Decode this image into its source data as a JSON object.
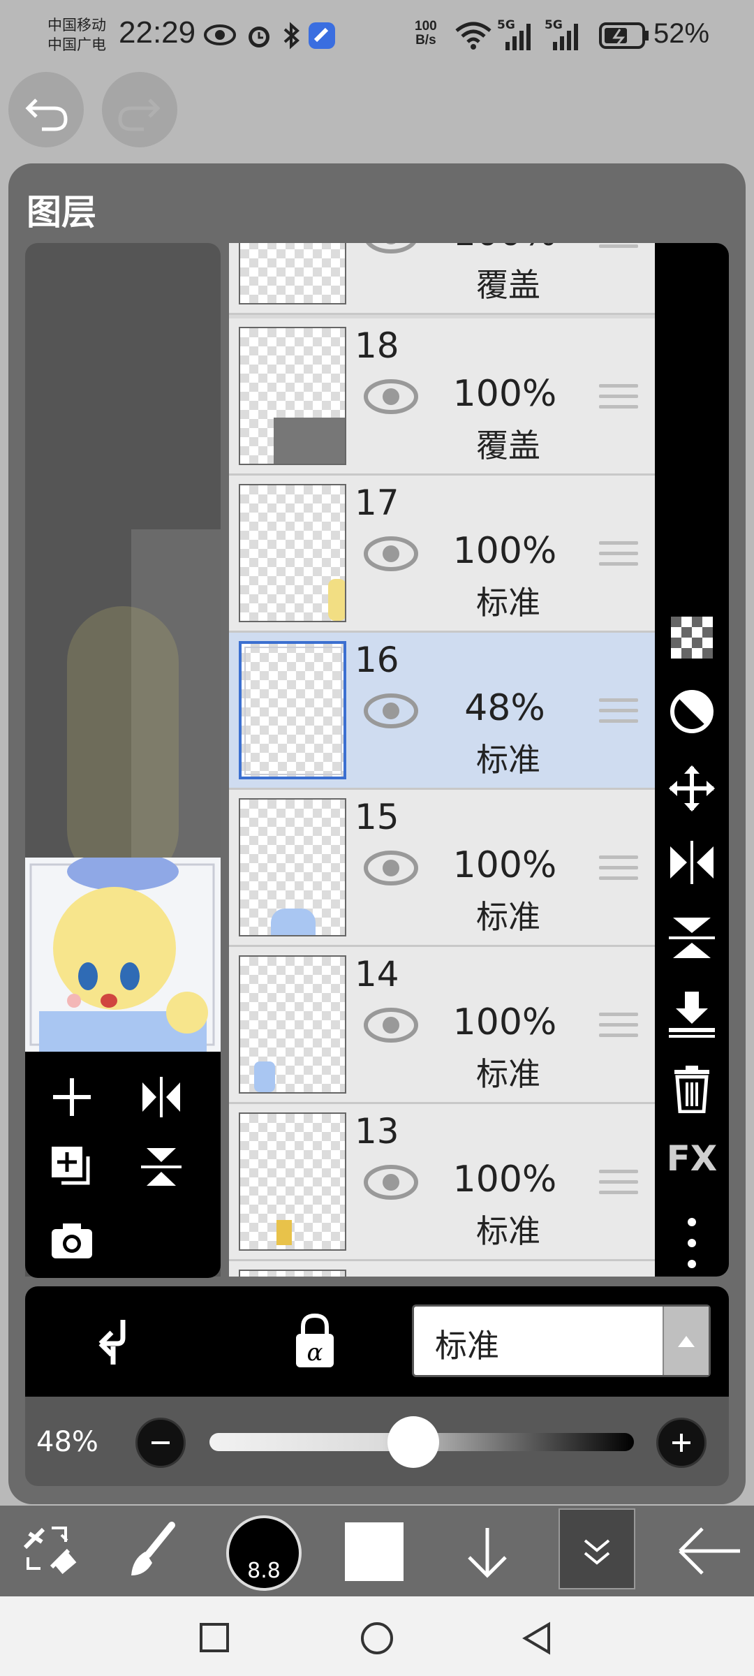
{
  "status_bar": {
    "carrier_line1": "中国移动",
    "carrier_line2": "中国广电",
    "time": "22:29",
    "net_speed_value": "100",
    "net_speed_unit": "B/s",
    "signal_1": "5G",
    "signal_2": "5G",
    "battery": "52%"
  },
  "panel": {
    "title": "图层"
  },
  "layers": [
    {
      "number": "",
      "opacity": "100%",
      "mode": "覆盖"
    },
    {
      "number": "18",
      "opacity": "100%",
      "mode": "覆盖"
    },
    {
      "number": "17",
      "opacity": "100%",
      "mode": "标准"
    },
    {
      "number": "16",
      "opacity": "48%",
      "mode": "标准",
      "selected": true
    },
    {
      "number": "15",
      "opacity": "100%",
      "mode": "标准"
    },
    {
      "number": "14",
      "opacity": "100%",
      "mode": "标准"
    },
    {
      "number": "13",
      "opacity": "100%",
      "mode": "标准"
    }
  ],
  "right_tools": {
    "fx_label": "FX"
  },
  "controls": {
    "blend_mode": "标准",
    "opacity_label": "48%",
    "opacity_value": 0.48
  },
  "toolbar": {
    "brush_size": "8.8"
  },
  "colors": {
    "panel": "#6b6b6b",
    "selected_row": "#cfdcf0",
    "selection_border": "#3b6fd0"
  }
}
